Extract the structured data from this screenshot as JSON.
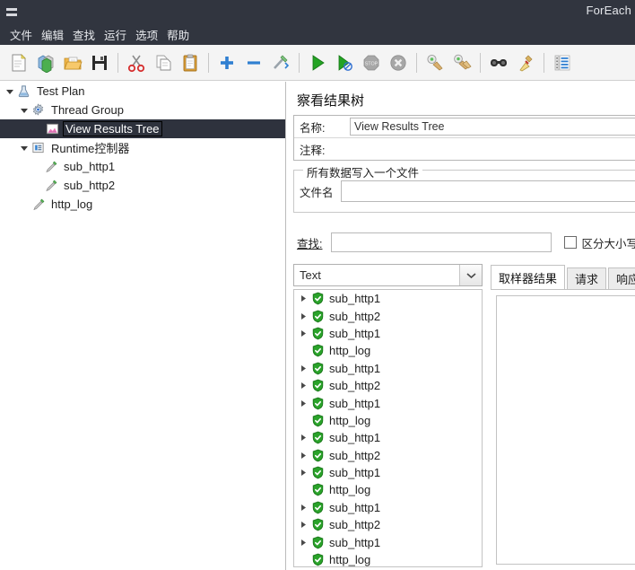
{
  "window": {
    "title": "ForEach",
    "menu_icon": "hamburger-icon"
  },
  "menubar": {
    "items": [
      {
        "label": "文件"
      },
      {
        "label": "编辑"
      },
      {
        "label": "查找"
      },
      {
        "label": "运行"
      },
      {
        "label": "选项"
      },
      {
        "label": "帮助"
      }
    ]
  },
  "toolbar": {
    "buttons": [
      {
        "name": "new-icon",
        "tip": "新建"
      },
      {
        "name": "templates-icon",
        "tip": "模板"
      },
      {
        "name": "open-icon",
        "tip": "打开"
      },
      {
        "name": "save-icon",
        "tip": "保存"
      },
      {
        "name": "cut-icon",
        "tip": "剪切"
      },
      {
        "name": "copy-icon",
        "tip": "复制"
      },
      {
        "name": "paste-icon",
        "tip": "粘贴"
      },
      {
        "name": "expand-all-icon",
        "tip": "展开全部"
      },
      {
        "name": "collapse-all-icon",
        "tip": "收起全部"
      },
      {
        "name": "toggle-icon",
        "tip": "切换"
      },
      {
        "name": "start-icon",
        "tip": "启动"
      },
      {
        "name": "start-no-pauses-icon",
        "tip": "无暂停启动"
      },
      {
        "name": "stop-icon",
        "tip": "停止"
      },
      {
        "name": "shutdown-icon",
        "tip": "关闭"
      },
      {
        "name": "clear-icon",
        "tip": "清除"
      },
      {
        "name": "clear-all-icon",
        "tip": "清除全部"
      },
      {
        "name": "search-icon",
        "tip": "搜索"
      },
      {
        "name": "search-reset-icon",
        "tip": "重置搜索"
      },
      {
        "name": "function-helper-icon",
        "tip": "函数助手"
      }
    ]
  },
  "tree": {
    "nodes": [
      {
        "label": "Test Plan",
        "indent": 0,
        "twisty": "down",
        "icon": "test-plan-icon",
        "selected": false
      },
      {
        "label": "Thread Group",
        "indent": 1,
        "twisty": "down",
        "icon": "thread-group-icon",
        "selected": false
      },
      {
        "label": "View Results Tree",
        "indent": 2,
        "twisty": "none",
        "icon": "view-results-tree-icon",
        "selected": true
      },
      {
        "label": "Runtime控制器",
        "indent": 1,
        "twisty": "down",
        "icon": "runtime-controller-icon",
        "selected": false
      },
      {
        "label": "sub_http1",
        "indent": 2,
        "twisty": "none",
        "icon": "http-sampler-icon",
        "selected": false
      },
      {
        "label": "sub_http2",
        "indent": 2,
        "twisty": "none",
        "icon": "http-sampler-icon",
        "selected": false
      },
      {
        "label": "http_log",
        "indent": 1,
        "twisty": "none",
        "icon": "http-sampler-icon",
        "selected": false
      }
    ]
  },
  "panel": {
    "title": "察看结果树",
    "name_label": "名称:",
    "name_value": "View Results Tree",
    "comment_label": "注释:",
    "comment_value": "",
    "file_group_title": "所有数据写入一个文件",
    "filename_label": "文件名",
    "filename_value": "",
    "search_label": "查找:",
    "search_value": "",
    "case_sensitive_label": "区分大小写",
    "case_sensitive_checked": false,
    "renderer_value": "Text",
    "renderer_options": [
      "Text"
    ],
    "tabs": [
      {
        "label": "取样器结果",
        "active": true
      },
      {
        "label": "请求",
        "active": false
      },
      {
        "label": "响应数据",
        "active": false
      }
    ],
    "results": [
      {
        "label": "sub_http1",
        "status": "ok",
        "expandable": true
      },
      {
        "label": "sub_http2",
        "status": "ok",
        "expandable": true
      },
      {
        "label": "sub_http1",
        "status": "ok",
        "expandable": true
      },
      {
        "label": "http_log",
        "status": "ok",
        "expandable": false
      },
      {
        "label": "sub_http1",
        "status": "ok",
        "expandable": true
      },
      {
        "label": "sub_http2",
        "status": "ok",
        "expandable": true
      },
      {
        "label": "sub_http1",
        "status": "ok",
        "expandable": true
      },
      {
        "label": "http_log",
        "status": "ok",
        "expandable": false
      },
      {
        "label": "sub_http1",
        "status": "ok",
        "expandable": true
      },
      {
        "label": "sub_http2",
        "status": "ok",
        "expandable": true
      },
      {
        "label": "sub_http1",
        "status": "ok",
        "expandable": true
      },
      {
        "label": "http_log",
        "status": "ok",
        "expandable": false
      },
      {
        "label": "sub_http1",
        "status": "ok",
        "expandable": true
      },
      {
        "label": "sub_http2",
        "status": "ok",
        "expandable": true
      },
      {
        "label": "sub_http1",
        "status": "ok",
        "expandable": true
      },
      {
        "label": "http_log",
        "status": "ok",
        "expandable": false
      }
    ]
  },
  "colors": {
    "titlebar": "#31353f",
    "selection": "#2e323d",
    "success_green": "#2aa32a",
    "accent_blue": "#2f7fd1"
  }
}
